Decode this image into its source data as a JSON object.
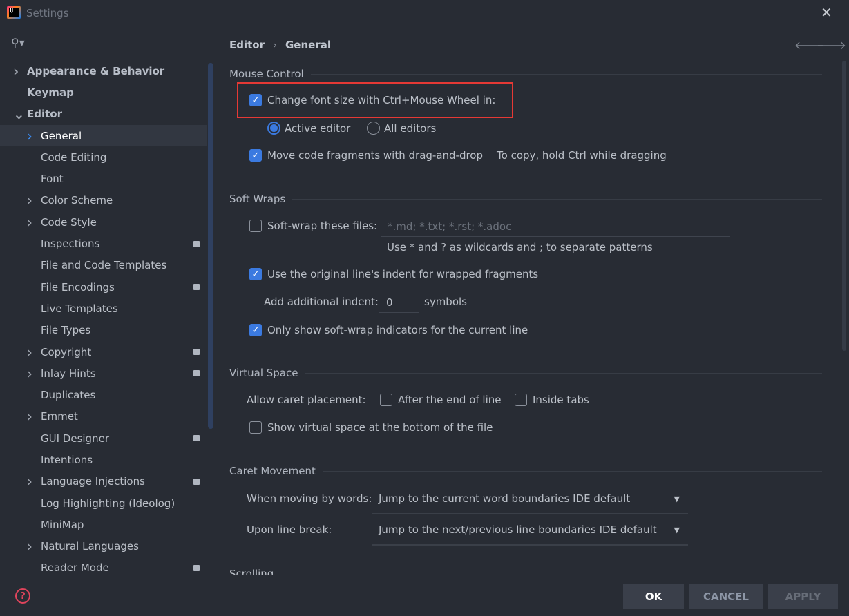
{
  "window": {
    "title": "Settings"
  },
  "sidebar": {
    "items": [
      {
        "label": "Appearance & Behavior",
        "level": 0,
        "chevron": ">",
        "bold": true
      },
      {
        "label": "Keymap",
        "level": 0,
        "chevron": "",
        "bold": true
      },
      {
        "label": "Editor",
        "level": 0,
        "chevron": "v",
        "bold": true
      },
      {
        "label": "General",
        "level": 1,
        "chevron": ">",
        "selected": true
      },
      {
        "label": "Code Editing",
        "level": 1,
        "chevron": ""
      },
      {
        "label": "Font",
        "level": 1,
        "chevron": ""
      },
      {
        "label": "Color Scheme",
        "level": 1,
        "chevron": ">"
      },
      {
        "label": "Code Style",
        "level": 1,
        "chevron": ">"
      },
      {
        "label": "Inspections",
        "level": 1,
        "chevron": "",
        "badge": true
      },
      {
        "label": "File and Code Templates",
        "level": 1,
        "chevron": ""
      },
      {
        "label": "File Encodings",
        "level": 1,
        "chevron": "",
        "badge": true
      },
      {
        "label": "Live Templates",
        "level": 1,
        "chevron": ""
      },
      {
        "label": "File Types",
        "level": 1,
        "chevron": ""
      },
      {
        "label": "Copyright",
        "level": 1,
        "chevron": ">",
        "badge": true
      },
      {
        "label": "Inlay Hints",
        "level": 1,
        "chevron": ">",
        "badge": true
      },
      {
        "label": "Duplicates",
        "level": 1,
        "chevron": ""
      },
      {
        "label": "Emmet",
        "level": 1,
        "chevron": ">"
      },
      {
        "label": "GUI Designer",
        "level": 1,
        "chevron": "",
        "badge": true
      },
      {
        "label": "Intentions",
        "level": 1,
        "chevron": ""
      },
      {
        "label": "Language Injections",
        "level": 1,
        "chevron": ">",
        "badge": true
      },
      {
        "label": "Log Highlighting (Ideolog)",
        "level": 1,
        "chevron": ""
      },
      {
        "label": "MiniMap",
        "level": 1,
        "chevron": ""
      },
      {
        "label": "Natural Languages",
        "level": 1,
        "chevron": ">"
      },
      {
        "label": "Reader Mode",
        "level": 1,
        "chevron": "",
        "badge": true
      }
    ]
  },
  "breadcrumb": {
    "parent": "Editor",
    "separator": "›",
    "current": "General"
  },
  "mouse": {
    "section": "Mouse Control",
    "change_font": "Change font size with Ctrl+Mouse Wheel in:",
    "change_font_checked": true,
    "active_editor": "Active editor",
    "all_editors": "All editors",
    "selected": "Active editor",
    "move_code": "Move code fragments with drag-and-drop",
    "move_code_checked": true,
    "move_hint": "To copy, hold Ctrl while dragging"
  },
  "softwraps": {
    "section": "Soft Wraps",
    "wrap_files": "Soft-wrap these files:",
    "wrap_files_checked": false,
    "wrap_placeholder": "*.md; *.txt; *.rst; *.adoc",
    "wrap_hint": "Use * and ? as wildcards and ; to separate patterns",
    "original_indent": "Use the original line's indent for wrapped fragments",
    "original_indent_checked": true,
    "add_indent": "Add additional indent:",
    "add_indent_value": "0",
    "symbols": "symbols",
    "only_current": "Only show soft-wrap indicators for the current line",
    "only_current_checked": true
  },
  "virtual": {
    "section": "Virtual Space",
    "caret_label": "Allow caret placement:",
    "after_end": "After the end of line",
    "inside_tabs": "Inside tabs",
    "show_bottom": "Show virtual space at the bottom of the file"
  },
  "caret": {
    "section": "Caret Movement",
    "words_label": "When moving by words:",
    "words_value": "Jump to the current word boundaries  IDE default",
    "line_label": "Upon line break:",
    "line_value": "Jump to the next/previous line boundaries  IDE default"
  },
  "scrolling": {
    "section": "Scrolling"
  },
  "buttons": {
    "ok": "OK",
    "cancel": "CANCEL",
    "apply": "APPLY"
  },
  "colors": {
    "accent": "#3b7ae0",
    "highlight": "#e53935",
    "background": "#282c34"
  }
}
